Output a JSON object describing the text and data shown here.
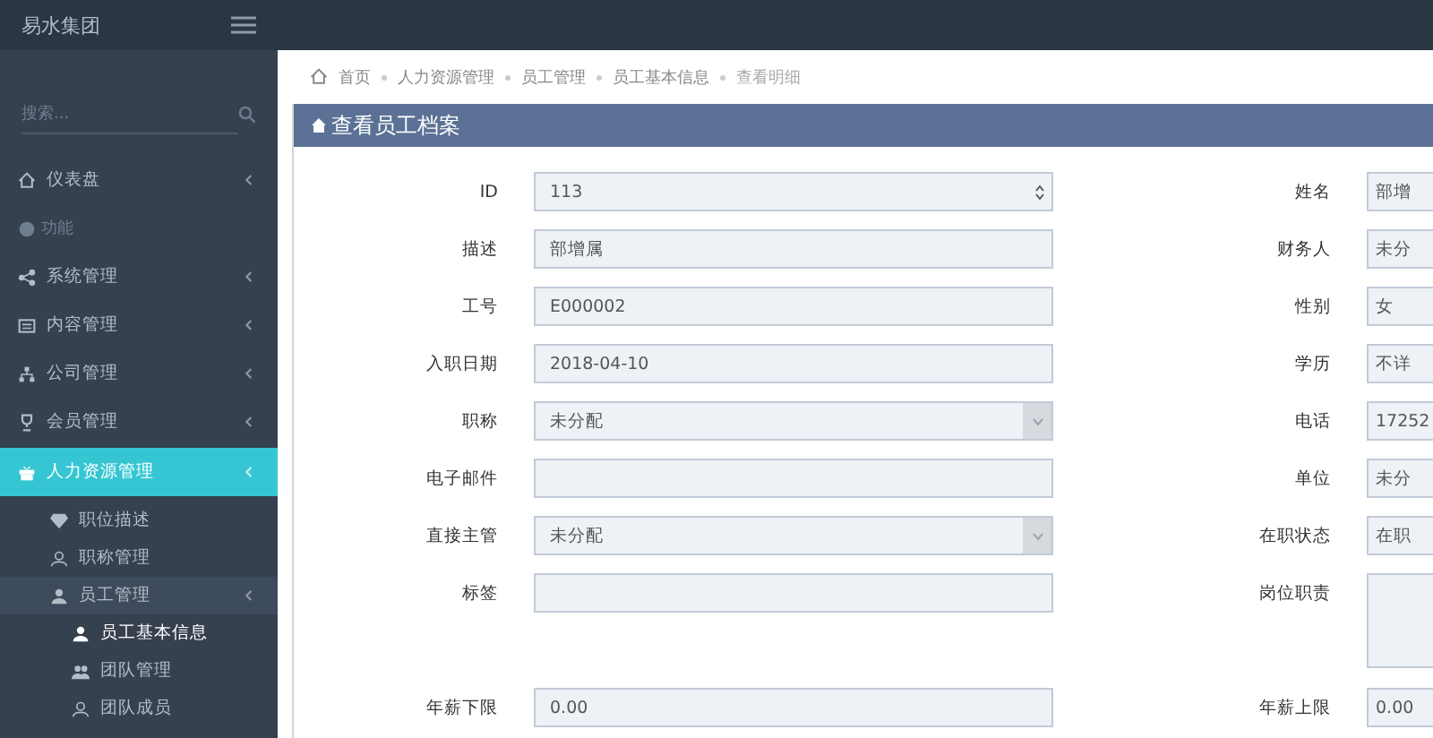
{
  "brand": "易水集团",
  "search": {
    "placeholder": "搜索..."
  },
  "menu": [
    {
      "label": "仪表盘",
      "kind": "link",
      "has_submenu": true,
      "selected": false
    },
    {
      "label": "功能",
      "kind": "heading",
      "has_submenu": false,
      "selected": false
    },
    {
      "label": "系统管理",
      "kind": "link",
      "has_submenu": true,
      "selected": false
    },
    {
      "label": "内容管理",
      "kind": "link",
      "has_submenu": true,
      "selected": false
    },
    {
      "label": "公司管理",
      "kind": "link",
      "has_submenu": true,
      "selected": false
    },
    {
      "label": "会员管理",
      "kind": "link",
      "has_submenu": true,
      "selected": false
    },
    {
      "label": "人力资源管理",
      "kind": "link",
      "has_submenu": true,
      "selected": true,
      "children": [
        {
          "label": "职位描述",
          "has_submenu": false,
          "selected": false
        },
        {
          "label": "职称管理",
          "has_submenu": false,
          "selected": false
        },
        {
          "label": "员工管理",
          "has_submenu": true,
          "selected": true,
          "children": [
            {
              "label": "员工基本信息",
              "selected": true
            },
            {
              "label": "团队管理",
              "selected": false
            },
            {
              "label": "团队成员",
              "selected": false
            }
          ]
        }
      ]
    }
  ],
  "breadcrumb": [
    "首页",
    "人力资源管理",
    "员工管理",
    "员工基本信息",
    "查看明细"
  ],
  "panel": {
    "title": "查看员工档案"
  },
  "left_fields": [
    {
      "label": "ID",
      "value": "113",
      "kind": "number"
    },
    {
      "label": "描述",
      "value": "部增属",
      "kind": "text"
    },
    {
      "label": "工号",
      "value": "E000002",
      "kind": "text"
    },
    {
      "label": "入职日期",
      "value": "2018-04-10",
      "kind": "text"
    },
    {
      "label": "职称",
      "value": "未分配",
      "kind": "select"
    },
    {
      "label": "电子邮件",
      "kind": "text"
    },
    {
      "label": "直接主管",
      "value": "未分配",
      "kind": "select"
    },
    {
      "label": "标签",
      "kind": "text"
    }
  ],
  "right_fields": [
    {
      "label": "姓名",
      "value": "部增",
      "kind": "text"
    },
    {
      "label": "财务人",
      "value": "未分",
      "kind": "text"
    },
    {
      "label": "性别",
      "value": "女",
      "kind": "text"
    },
    {
      "label": "学历",
      "value": "不详",
      "kind": "text"
    },
    {
      "label": "电话",
      "value": "17252",
      "kind": "text"
    },
    {
      "label": "单位",
      "value": "未分",
      "kind": "text"
    },
    {
      "label": "在职状态",
      "value": "在职",
      "kind": "text"
    },
    {
      "label": "岗位职责",
      "kind": "textarea"
    }
  ],
  "salary_fields": [
    {
      "label": "年薪下限",
      "value": "0.00",
      "kind": "text"
    },
    {
      "label": "年薪上限",
      "value": "0.00",
      "kind": "text"
    }
  ]
}
